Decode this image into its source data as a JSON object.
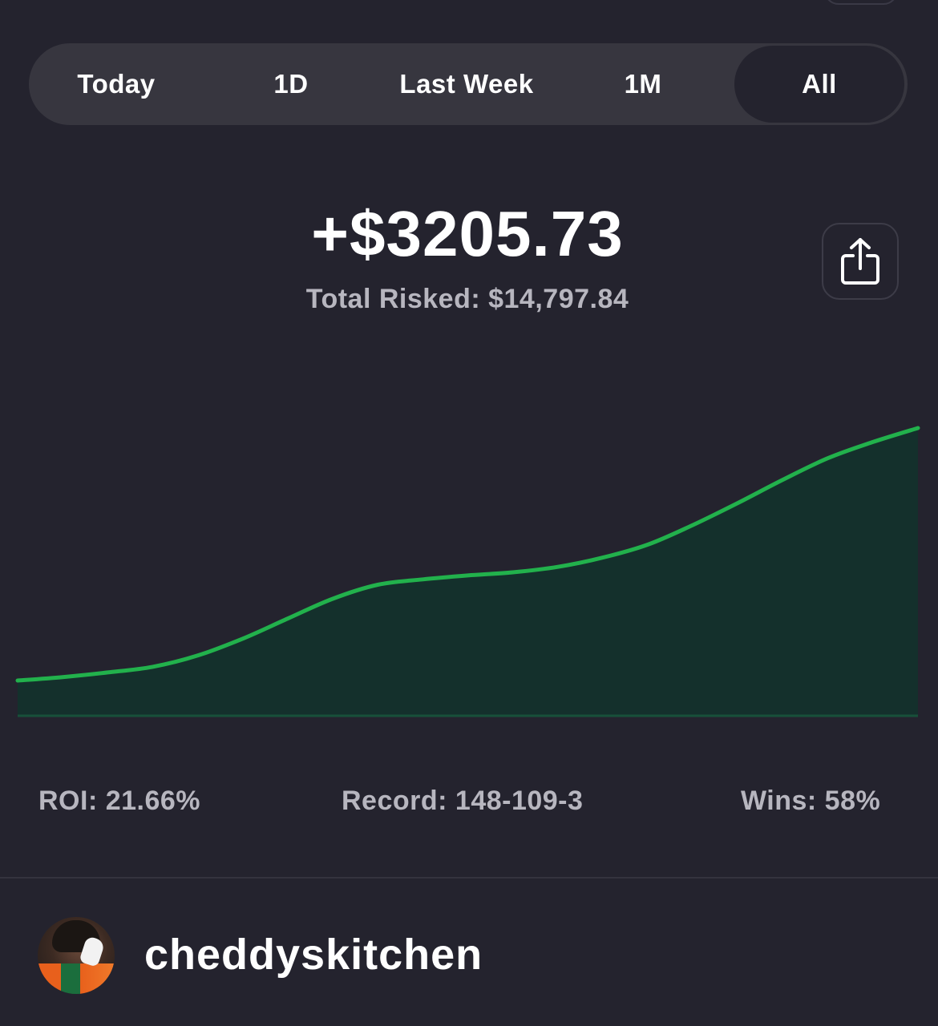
{
  "range_tabs": [
    {
      "label": "Today",
      "active": false
    },
    {
      "label": "1D",
      "active": false
    },
    {
      "label": "Last Week",
      "active": false
    },
    {
      "label": "1M",
      "active": false
    },
    {
      "label": "All",
      "active": true
    }
  ],
  "summary": {
    "profit": "+$3205.73",
    "total_risked": "Total Risked: $14,797.84"
  },
  "share": {
    "icon": "share-icon"
  },
  "chart_data": {
    "type": "area",
    "title": "",
    "xlabel": "",
    "ylabel": "",
    "y_unit": "USD",
    "grid": false,
    "legend": "none",
    "ylim": [
      0,
      3205.73
    ],
    "series": [
      {
        "values": [
          0,
          14,
          33,
          56,
          102,
          171,
          253,
          334,
          391,
          413,
          429,
          442,
          464,
          502,
          555,
          635,
          725,
          820,
          908,
          974,
          1031
        ]
      }
    ],
    "line_color": "#22b14c",
    "fill_color": "#14302c"
  },
  "stats": {
    "roi": "ROI: 21.66%",
    "record": "Record: 148-109-3",
    "wins": "Wins: 58%"
  },
  "profile": {
    "username": "cheddyskitchen",
    "avatar": "avatar"
  }
}
